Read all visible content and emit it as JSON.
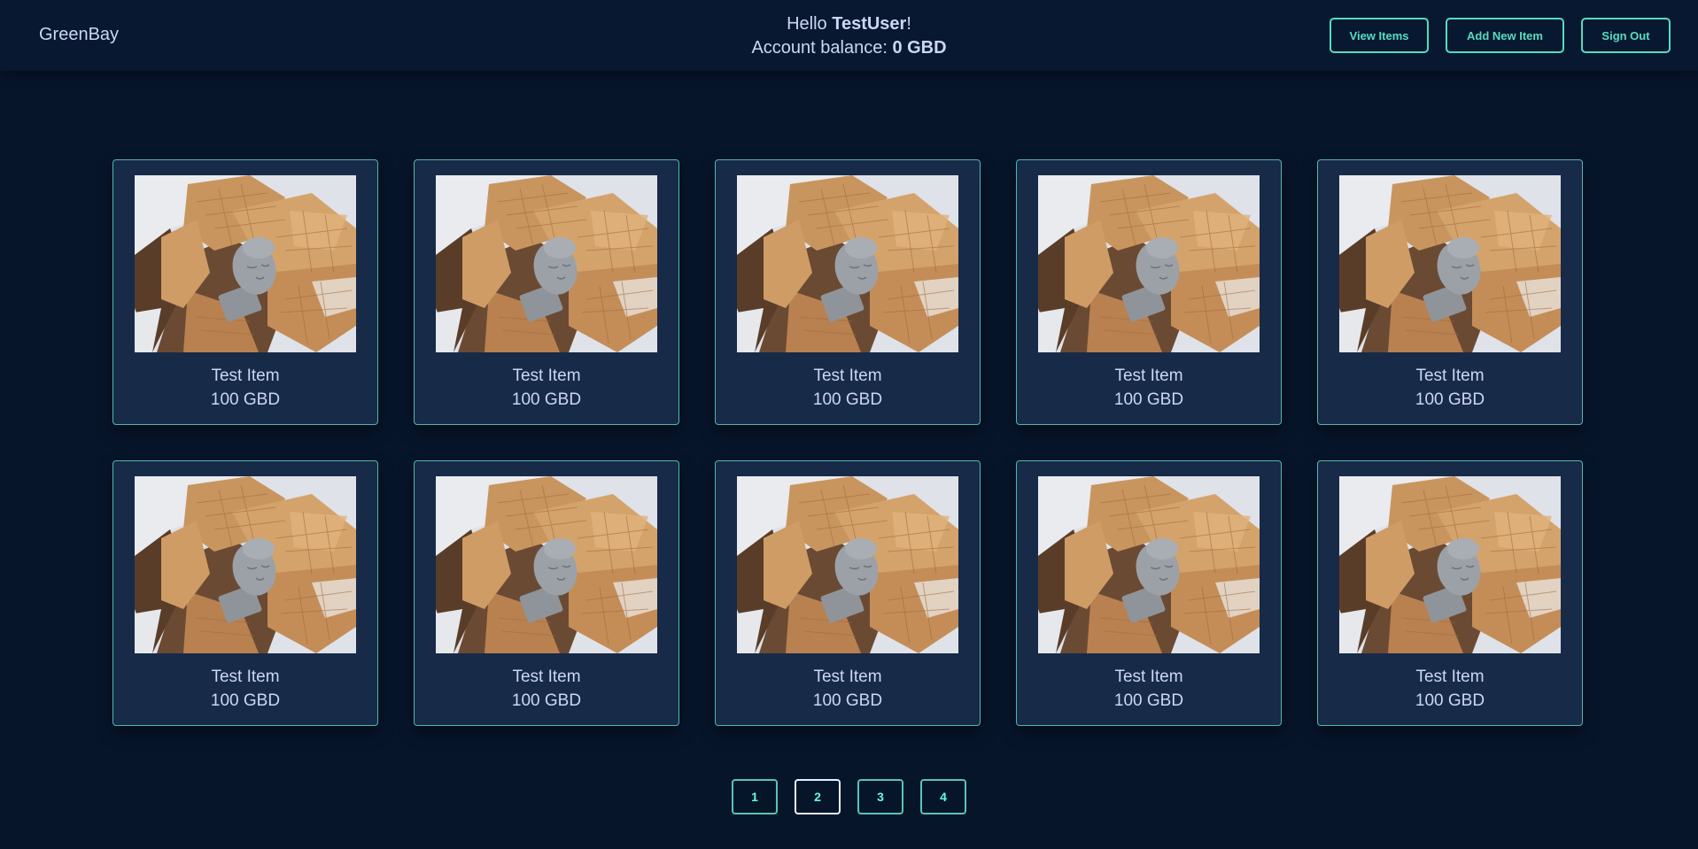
{
  "header": {
    "brand": "GreenBay",
    "greeting_prefix": "Hello ",
    "username": "TestUser",
    "greeting_suffix": "!",
    "balance_prefix": "Account balance: ",
    "balance_value": "0 GBD",
    "buttons": {
      "view_items": "View Items",
      "add_new_item": "Add New Item",
      "sign_out": "Sign Out"
    }
  },
  "items": [
    {
      "name": "Test Item",
      "price": "100 GBD"
    },
    {
      "name": "Test Item",
      "price": "100 GBD"
    },
    {
      "name": "Test Item",
      "price": "100 GBD"
    },
    {
      "name": "Test Item",
      "price": "100 GBD"
    },
    {
      "name": "Test Item",
      "price": "100 GBD"
    },
    {
      "name": "Test Item",
      "price": "100 GBD"
    },
    {
      "name": "Test Item",
      "price": "100 GBD"
    },
    {
      "name": "Test Item",
      "price": "100 GBD"
    },
    {
      "name": "Test Item",
      "price": "100 GBD"
    },
    {
      "name": "Test Item",
      "price": "100 GBD"
    }
  ],
  "pagination": {
    "pages": [
      "1",
      "2",
      "3",
      "4"
    ],
    "current": "2"
  },
  "colors": {
    "background": "#07152b",
    "card": "#172a48",
    "accent": "#64ffda",
    "text": "#ccd6f6"
  }
}
